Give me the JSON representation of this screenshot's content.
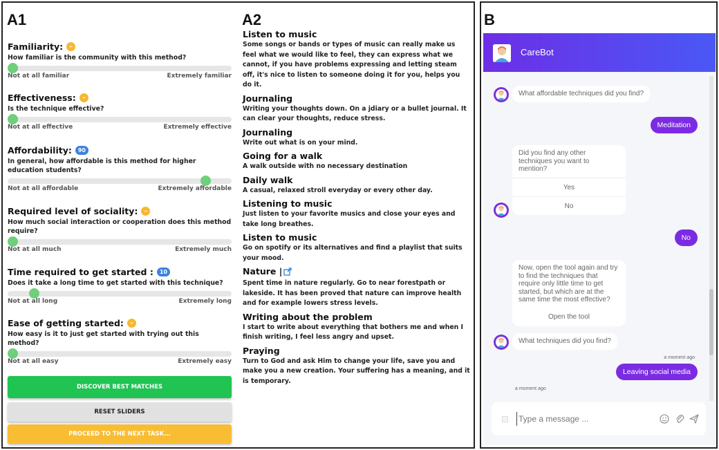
{
  "panel_labels": {
    "a1": "A1",
    "a2": "A2",
    "b": "B"
  },
  "sliders": [
    {
      "title": "Familiarity:",
      "badge": "",
      "question": "How familiar is the community with this method?",
      "min_label": "Not at all familiar",
      "max_label": "Extremely familiar",
      "value_fraction": 0.0
    },
    {
      "title": "Effectiveness:",
      "badge": "",
      "question": "Is the technique effective?",
      "min_label": "Not at all effective",
      "max_label": "Extremely effective",
      "value_fraction": 0.0
    },
    {
      "title": "Affordability:",
      "badge": "90",
      "question": "In general, how affordable is this method for higher education students?",
      "min_label": "Not at all affordable",
      "max_label": "Extremely affordable",
      "value_fraction": 0.9
    },
    {
      "title": "Required level of sociality:",
      "badge": "",
      "question": "How much social interaction or cooperation does this method require?",
      "min_label": "Not at all much",
      "max_label": "Extremely much",
      "value_fraction": 0.0
    },
    {
      "title": "Time required to get started :",
      "badge": "10",
      "question": "Does it take a long time to get started with this technique?",
      "min_label": "Not at all long",
      "max_label": "Extremely long",
      "value_fraction": 0.1
    },
    {
      "title": "Ease of getting started:",
      "badge": "",
      "question": "How easy is it to just get started with trying out this method?",
      "min_label": "Not at all easy",
      "max_label": "Extremely easy",
      "value_fraction": 0.0
    }
  ],
  "buttons": {
    "discover": "DISCOVER BEST MATCHES",
    "reset": "RESET SLIDERS",
    "proceed": "PROCEED TO THE NEXT TASK..."
  },
  "techniques": [
    {
      "title": "Listen to music",
      "desc": "Some songs or bands or types of music can really make us feel what we would like to feel, they can express what we cannot, if you have problems expressing and letting steam off, it's nice to listen to someone doing it for you, helps you do it."
    },
    {
      "title": "Journaling",
      "desc": "Writing your thoughts down. On a jdiary or a bullet journal. It can clear your thoughts, reduce stress."
    },
    {
      "title": "Journaling",
      "desc": "Write out what is on your mind."
    },
    {
      "title": "Going for a walk",
      "desc": "A walk outside with no necessary destination"
    },
    {
      "title": "Daily walk",
      "desc": "A casual, relaxed stroll everyday or every other day."
    },
    {
      "title": "Listening to music",
      "desc": "Just listen to your favorite musics and close your eyes and take long breathes."
    },
    {
      "title": "Listen to music",
      "desc": "Go on spotify or its alternatives and find a playlist that suits your mood."
    },
    {
      "title": "Nature |",
      "desc": "Spent time in nature regularly. Go to near forestpath or lakeside. It has been proved that nature can improve health and for example lowers stress levels.",
      "has_link": true
    },
    {
      "title": "Writing about the problem",
      "desc": "I start to write about everything that bothers me and when I finish writing, I feel less angry and upset."
    },
    {
      "title": "Praying",
      "desc": "Turn to God and ask Him to change your life, save you and make you a new creation. Your suffering has a meaning, and it is temporary."
    }
  ],
  "chat": {
    "bot_name": "CareBot",
    "header_color": "#6d2ee6",
    "user_bubble_color": "#7b2ce3",
    "messages": {
      "bot_1": "What affordable techniques did you find?",
      "user_1": "Meditation",
      "bot_2": "Did you find any other techniques you want to mention?",
      "bot_2_option_yes": "Yes",
      "bot_2_option_no": "No",
      "user_2": "No",
      "bot_3": "Now, open the tool again and try to find the techniques that require only little time to get started, but which are at the same time the most effective?",
      "bot_3_option": "Open the tool",
      "bot_4": "What techniques did you find?",
      "user_3_time": "a moment ago",
      "user_3": "Leaving social media",
      "bot_4_time": "a moment ago"
    },
    "composer": {
      "placeholder": "Type a message ..."
    },
    "icons": [
      "emoji-icon",
      "paperclip-icon",
      "send-icon"
    ]
  }
}
